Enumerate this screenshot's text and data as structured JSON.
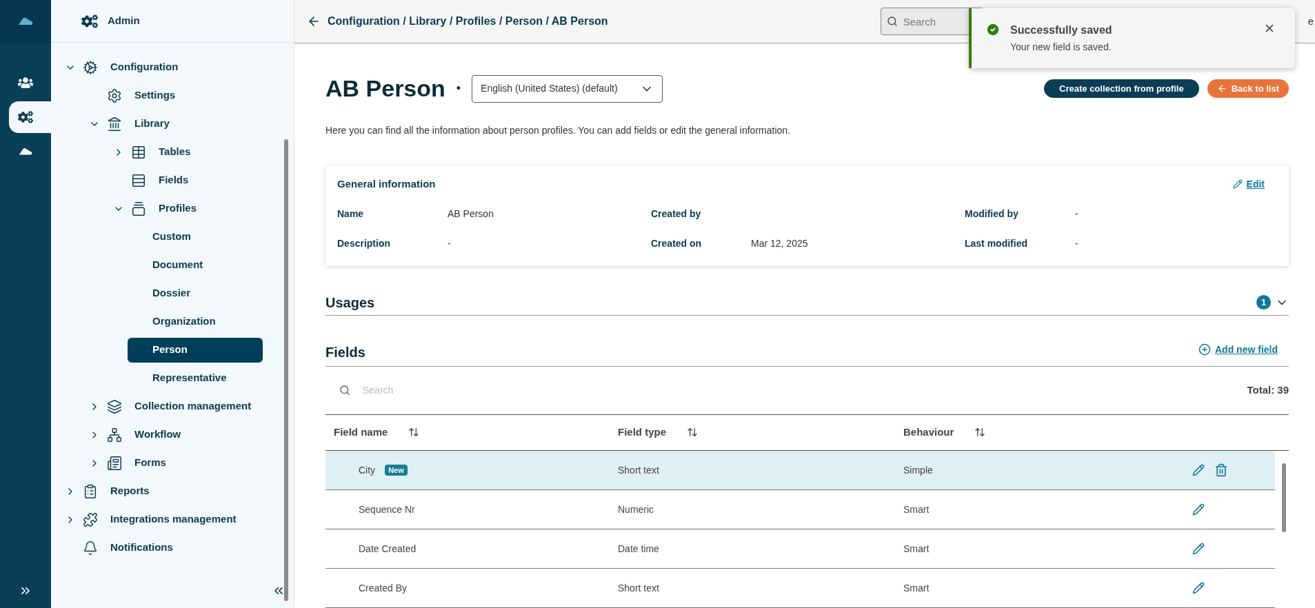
{
  "rail": {
    "items": [
      {
        "selected": false
      },
      {
        "selected": true
      },
      {
        "selected": false
      }
    ]
  },
  "nav": {
    "title": "Admin",
    "items": [
      {
        "label": "Configuration",
        "expanded": true,
        "selected": false,
        "children": [
          {
            "label": "Settings",
            "selected": false
          },
          {
            "label": "Library",
            "expanded": true,
            "selected": false,
            "children": [
              {
                "label": "Tables",
                "expanded": false,
                "selected": false
              },
              {
                "label": "Fields",
                "selected": false
              },
              {
                "label": "Profiles",
                "expanded": true,
                "selected": false,
                "children": [
                  {
                    "label": "Custom",
                    "selected": false
                  },
                  {
                    "label": "Document",
                    "selected": false
                  },
                  {
                    "label": "Dossier",
                    "selected": false
                  },
                  {
                    "label": "Organization",
                    "selected": false
                  },
                  {
                    "label": "Person",
                    "selected": true
                  },
                  {
                    "label": "Representative",
                    "selected": false
                  }
                ]
              }
            ]
          },
          {
            "label": "Collection management",
            "expanded": false,
            "selected": false
          },
          {
            "label": "Workflow",
            "expanded": false,
            "selected": false
          },
          {
            "label": "Forms",
            "expanded": false,
            "selected": false
          }
        ]
      },
      {
        "label": "Reports",
        "expanded": false,
        "selected": false
      },
      {
        "label": "Integrations management",
        "expanded": false,
        "selected": false
      },
      {
        "label": "Notifications",
        "selected": false
      }
    ]
  },
  "header": {
    "breadcrumb": "Configuration / Library / Profiles / Person / AB Person",
    "search": {
      "placeholder": "Search"
    },
    "user": "e"
  },
  "toast": {
    "title": "Successfully saved",
    "message": "Your new field is saved."
  },
  "page": {
    "title": "AB Person",
    "status_dot": "•",
    "language": "English (United States) (default)",
    "buttons": [
      {
        "label": "Create collection from profile",
        "kind": "primary"
      },
      {
        "label": "Back to list",
        "kind": "back"
      }
    ],
    "description": "Here you can find all the information about person profiles. You can add fields or edit the general information."
  },
  "general_info": {
    "title": "General information",
    "edit": "Edit",
    "fields": [
      {
        "label": "Name",
        "value": "AB Person"
      },
      {
        "label": "Created by"
      },
      {
        "label": "Modified by",
        "value": "-"
      },
      {
        "label": "Description",
        "value": "-"
      },
      {
        "label": "Created on",
        "value": "Mar 12, 2025"
      },
      {
        "label": "Last modified",
        "value": "-"
      }
    ]
  },
  "usages": {
    "title": "Usages",
    "count": "1",
    "expanded": false
  },
  "fields": {
    "title": "Fields",
    "add": "Add new field",
    "search": {
      "placeholder": "Search"
    },
    "total": "Total: 39",
    "columns": [
      "Field name",
      "Field type",
      "Behaviour"
    ],
    "rows": [
      {
        "name": "City",
        "badge": "New",
        "type": "Short text",
        "behaviour": "Simple",
        "selected": true,
        "deletable": true
      },
      {
        "name": "Sequence Nr",
        "type": "Numeric",
        "behaviour": "Smart",
        "selected": false,
        "deletable": false
      },
      {
        "name": "Date Created",
        "type": "Date time",
        "behaviour": "Smart",
        "selected": false,
        "deletable": false
      },
      {
        "name": "Created By",
        "type": "Short text",
        "behaviour": "Smart",
        "selected": false,
        "deletable": false
      }
    ]
  }
}
